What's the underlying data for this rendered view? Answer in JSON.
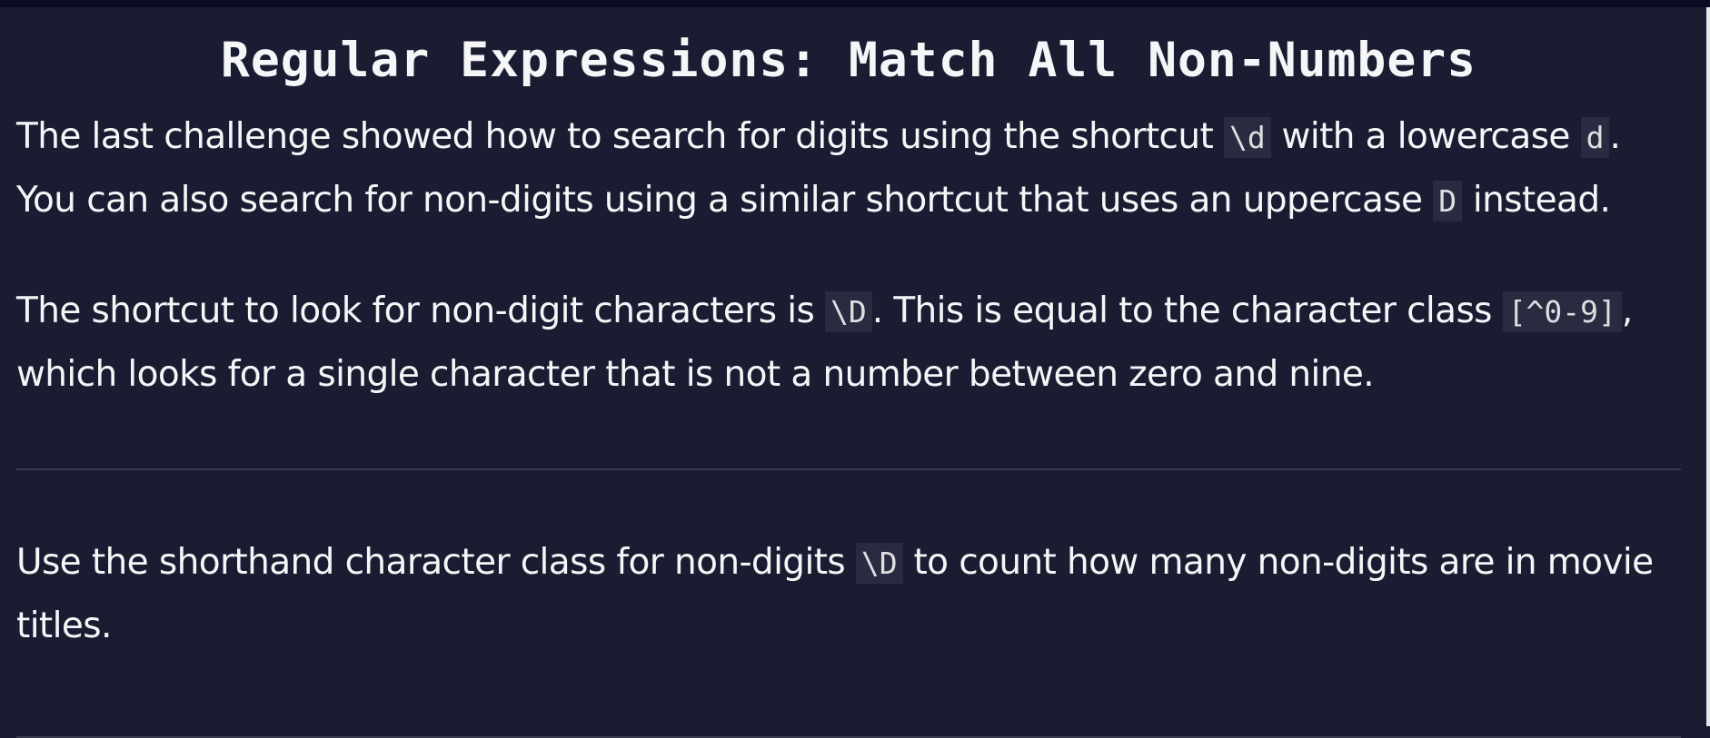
{
  "challenge": {
    "title": "Regular Expressions: Match All Non-Numbers",
    "paragraph1": {
      "t1": "The last challenge showed how to search for digits using the shortcut ",
      "c1": "\\d",
      "t2": " with a lowercase ",
      "c2": "d",
      "t3": ". You can also search for non-digits using a similar shortcut that uses an uppercase ",
      "c3": "D",
      "t4": " instead."
    },
    "paragraph2": {
      "t1": "The shortcut to look for non-digit characters is ",
      "c1": "\\D",
      "t2": ". This is equal to the character class ",
      "c2": "[^0-9]",
      "t3": ", which looks for a single character that is not a number between zero and nine."
    },
    "instructions": {
      "t1": "Use the shorthand character class for non-digits ",
      "c1": "\\D",
      "t2": " to count how many non-digits are in movie titles."
    }
  }
}
